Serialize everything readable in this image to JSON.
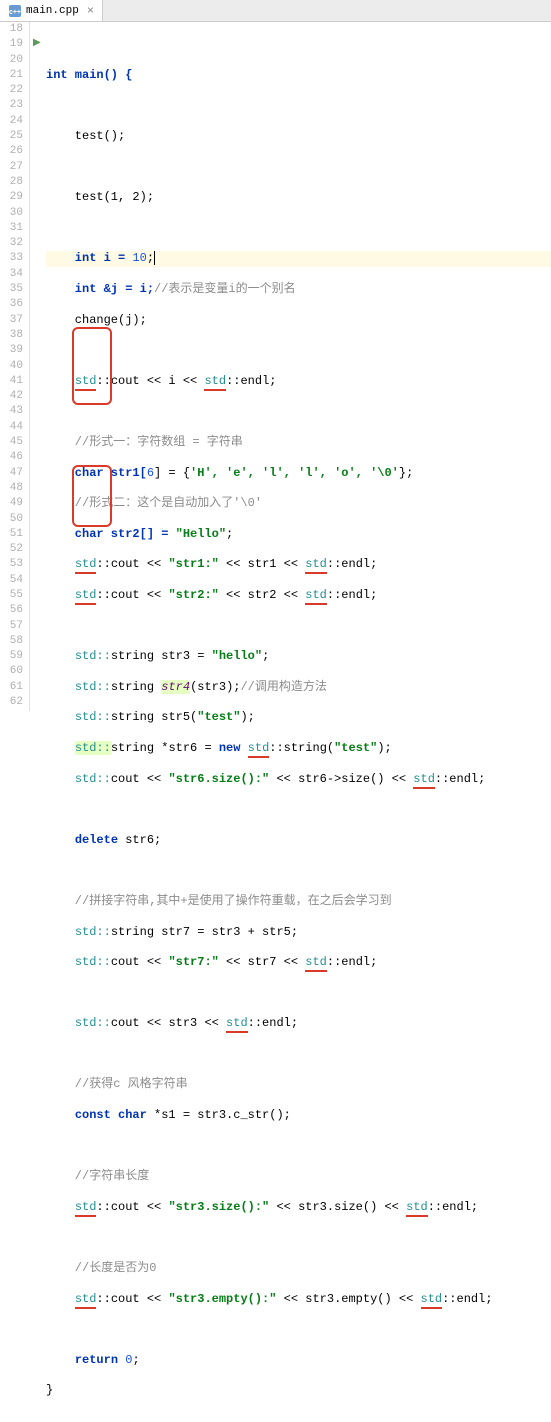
{
  "tab": {
    "filename": "main.cpp"
  },
  "gutter": {
    "start": 18,
    "end": 62
  },
  "code": {
    "l19": "int main() {",
    "l21": "    test();",
    "l23": "    test(1, 2);",
    "l25a": "    int i = ",
    "l25b": "10",
    "l25c": ";",
    "l26a": "    int &j = i;",
    "l26b": "//表示是变量i的一个别名",
    "l27": "    change(j);",
    "l29a": "    ",
    "l29b": "std",
    "l29c": "::cout << i << ",
    "l29d": "std",
    "l29e": "::endl;",
    "l31": "    //形式一：字符数组 = 字符串",
    "l32a": "    char str1[",
    "l32n": "6",
    "l32b": "] = {",
    "l32c": "'H', 'e', 'l', 'l', 'o', '\\0'",
    "l32d": "};",
    "l33": "    //形式二：这个是自动加入了'\\0'",
    "l34a": "    char str2[] = ",
    "l34b": "\"Hello\"",
    "l34c": ";",
    "l35a": "    ",
    "l35b": "std",
    "l35c": "::cout << ",
    "l35d": "\"str1:\"",
    "l35e": " << str1 << ",
    "l35f": "std",
    "l35g": "::endl;",
    "l36a": "    ",
    "l36b": "std",
    "l36c": "::cout << ",
    "l36d": "\"str2:\"",
    "l36e": " << str2 << ",
    "l36f": "std",
    "l36g": "::endl;",
    "l38a": "    ",
    "l38b": "std::",
    "l38c": "string str3 = ",
    "l38d": "\"hello\"",
    "l38e": ";",
    "l39a": "    ",
    "l39b": "std::",
    "l39c": "string ",
    "l39s": "str4",
    "l39d": "(str3);",
    "l39e": "//调用构造方法",
    "l40a": "    ",
    "l40b": "std::",
    "l40c": "string str5(",
    "l40d": "\"test\"",
    "l40e": ");",
    "l41a": "    ",
    "l41b": "std::",
    "l41c": "string *str6 = ",
    "l41d": "new ",
    "l41e": "std",
    "l41f": "::string(",
    "l41g": "\"test\"",
    "l41h": ");",
    "l42a": "    ",
    "l42b": "std::",
    "l42c": "cout << ",
    "l42d": "\"str6.size():\"",
    "l42e": " << str6->size() << ",
    "l42f": "std",
    "l42g": "::endl;",
    "l44a": "    ",
    "l44b": "delete",
    "l44c": " str6;",
    "l46": "    //拼接字符串,其中+是使用了操作符重载，在之后会学习到",
    "l47a": "    ",
    "l47b": "std::",
    "l47c": "string str7 = str3 + str5;",
    "l48a": "    ",
    "l48b": "std::",
    "l48c": "cout << ",
    "l48d": "\"str7:\"",
    "l48e": " << str7 << ",
    "l48f": "std",
    "l48g": "::endl;",
    "l50a": "    ",
    "l50b": "std::",
    "l50c": "cout << str3 << ",
    "l50d": "std",
    "l50e": "::endl;",
    "l52": "    //获得c 风格字符串",
    "l53a": "    ",
    "l53b": "const char",
    "l53c": " *s1 = str3.c_str();",
    "l55": "    //字符串长度",
    "l56a": "    ",
    "l56b": "std",
    "l56c": "::cout << ",
    "l56d": "\"str3.size():\"",
    "l56e": " << str3.size() << ",
    "l56f": "std",
    "l56g": "::endl;",
    "l58": "    //长度是否为0",
    "l59a": "    ",
    "l59b": "std",
    "l59c": "::cout << ",
    "l59d": "\"str3.empty():\"",
    "l59e": " << str3.empty() << ",
    "l59f": "std",
    "l59g": "::endl;",
    "l61a": "    ",
    "l61b": "return ",
    "l61c": "0",
    "l61d": ";",
    "l62": "}"
  },
  "chart_data": null
}
